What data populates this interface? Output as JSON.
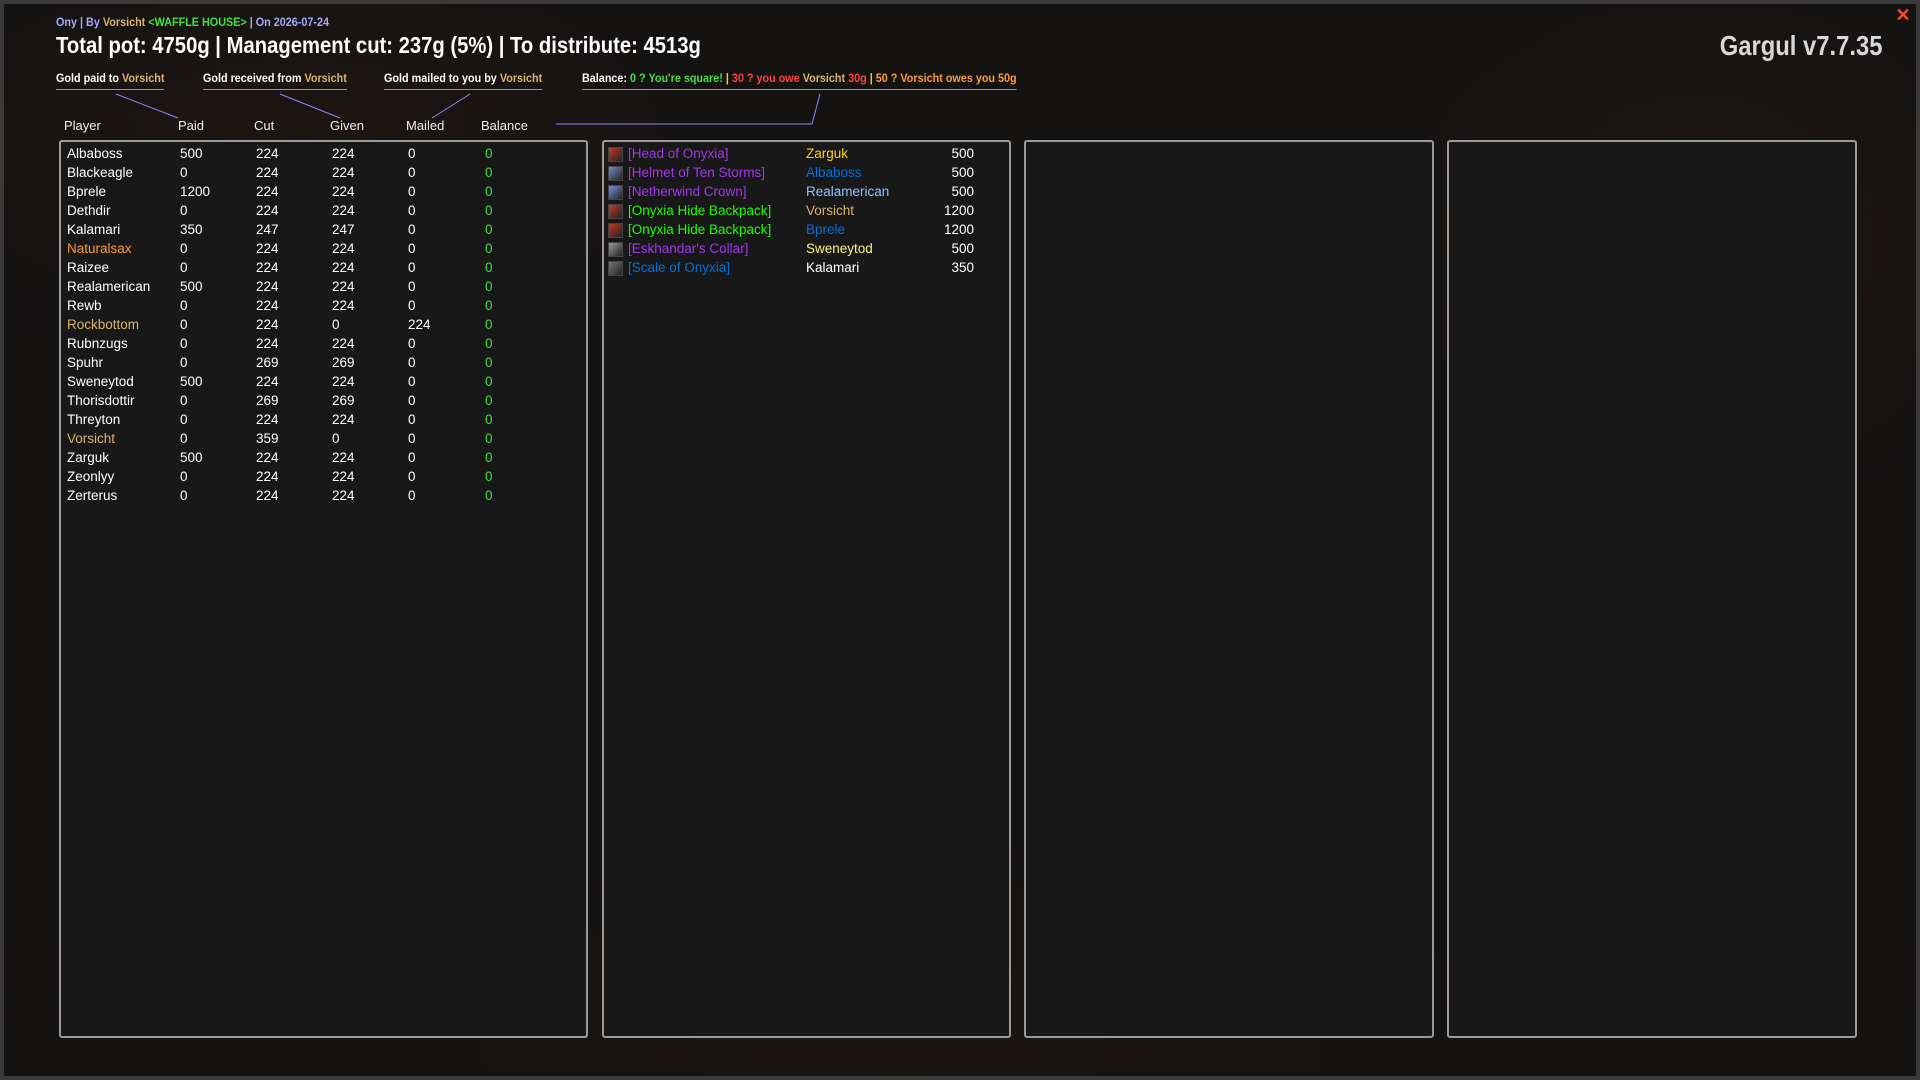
{
  "header": {
    "raid": "Ony",
    "by_prefix": "By",
    "author": "Vorsicht",
    "guild": "<WAFFLE HOUSE>",
    "on_prefix": "On",
    "date": "2026-07-24",
    "headline": "Total pot: 4750g | Management cut: 237g (5%) | To distribute: 4513g",
    "version": "Gargul v7.7.35"
  },
  "legend": {
    "paid_label": "Gold paid to",
    "received_label": "Gold received from",
    "mailed_label": "Gold mailed to you by",
    "name": "Vorsicht",
    "balance_label": "Balance:",
    "square": "0 ? You're square!",
    "owe_prefix": "30 ? you owe",
    "owe_amount": "30g",
    "owes_you": "50 ? Vorsicht owes you 50g",
    "sep": "|"
  },
  "columns": {
    "player": "Player",
    "paid": "Paid",
    "cut": "Cut",
    "given": "Given",
    "mailed": "Mailed",
    "balance": "Balance"
  },
  "colors": {
    "default_name": "#ffffff",
    "orange_name": "#ff9a30",
    "gold_name": "#d9b46b",
    "balance": "#40e040",
    "epic": "#a335ee",
    "uncommon": "#1eff00",
    "rare": "#0070dd",
    "legend_line": "#8888ff"
  },
  "players": [
    {
      "name": "Albaboss",
      "paid": "500",
      "cut": "224",
      "given": "224",
      "mailed": "0",
      "balance": "0",
      "color": "#ffffff"
    },
    {
      "name": "Blackeagle",
      "paid": "0",
      "cut": "224",
      "given": "224",
      "mailed": "0",
      "balance": "0",
      "color": "#ffffff"
    },
    {
      "name": "Bprele",
      "paid": "1200",
      "cut": "224",
      "given": "224",
      "mailed": "0",
      "balance": "0",
      "color": "#ffffff"
    },
    {
      "name": "Dethdir",
      "paid": "0",
      "cut": "224",
      "given": "224",
      "mailed": "0",
      "balance": "0",
      "color": "#ffffff"
    },
    {
      "name": "Kalamari",
      "paid": "350",
      "cut": "247",
      "given": "247",
      "mailed": "0",
      "balance": "0",
      "color": "#ffffff"
    },
    {
      "name": "Naturalsax",
      "paid": "0",
      "cut": "224",
      "given": "224",
      "mailed": "0",
      "balance": "0",
      "color": "#ff9a30"
    },
    {
      "name": "Raizee",
      "paid": "0",
      "cut": "224",
      "given": "224",
      "mailed": "0",
      "balance": "0",
      "color": "#ffffff"
    },
    {
      "name": "Realamerican",
      "paid": "500",
      "cut": "224",
      "given": "224",
      "mailed": "0",
      "balance": "0",
      "color": "#ffffff"
    },
    {
      "name": "Rewb",
      "paid": "0",
      "cut": "224",
      "given": "224",
      "mailed": "0",
      "balance": "0",
      "color": "#ffffff"
    },
    {
      "name": "Rockbottom",
      "paid": "0",
      "cut": "224",
      "given": "0",
      "mailed": "224",
      "balance": "0",
      "color": "#d9b46b"
    },
    {
      "name": "Rubnzugs",
      "paid": "0",
      "cut": "224",
      "given": "224",
      "mailed": "0",
      "balance": "0",
      "color": "#ffffff"
    },
    {
      "name": "Spuhr",
      "paid": "0",
      "cut": "269",
      "given": "269",
      "mailed": "0",
      "balance": "0",
      "color": "#ffffff"
    },
    {
      "name": "Sweneytod",
      "paid": "500",
      "cut": "224",
      "given": "224",
      "mailed": "0",
      "balance": "0",
      "color": "#ffffff"
    },
    {
      "name": "Thorisdottir",
      "paid": "0",
      "cut": "269",
      "given": "269",
      "mailed": "0",
      "balance": "0",
      "color": "#ffffff"
    },
    {
      "name": "Threyton",
      "paid": "0",
      "cut": "224",
      "given": "224",
      "mailed": "0",
      "balance": "0",
      "color": "#ffffff"
    },
    {
      "name": "Vorsicht",
      "paid": "0",
      "cut": "359",
      "given": "0",
      "mailed": "0",
      "balance": "0",
      "color": "#d9b46b"
    },
    {
      "name": "Zarguk",
      "paid": "500",
      "cut": "224",
      "given": "224",
      "mailed": "0",
      "balance": "0",
      "color": "#ffffff"
    },
    {
      "name": "Zeonlyy",
      "paid": "0",
      "cut": "224",
      "given": "224",
      "mailed": "0",
      "balance": "0",
      "color": "#ffffff"
    },
    {
      "name": "Zerterus",
      "paid": "0",
      "cut": "224",
      "given": "224",
      "mailed": "0",
      "balance": "0",
      "color": "#ffffff"
    }
  ],
  "loot": [
    {
      "item": "[Head of Onyxia]",
      "item_color": "#a335ee",
      "icon": "onyxia-head-icon",
      "icon_color": "#c0392b",
      "winner": "Zarguk",
      "winner_color": "#ffd200",
      "price": "500"
    },
    {
      "item": "[Helmet of Ten Storms]",
      "item_color": "#a335ee",
      "icon": "helmet-icon",
      "icon_color": "#6f8ec9",
      "winner": "Albaboss",
      "winner_color": "#0070dd",
      "price": "500"
    },
    {
      "item": "[Netherwind Crown]",
      "item_color": "#a335ee",
      "icon": "crown-icon",
      "icon_color": "#7a8fd8",
      "winner": "Realamerican",
      "winner_color": "#8ec5ff",
      "price": "500"
    },
    {
      "item": "[Onyxia Hide Backpack]",
      "item_color": "#1eff00",
      "icon": "backpack-icon",
      "icon_color": "#c0392b",
      "winner": "Vorsicht",
      "winner_color": "#d9b46b",
      "price": "1200"
    },
    {
      "item": "[Onyxia Hide Backpack]",
      "item_color": "#1eff00",
      "icon": "backpack-icon",
      "icon_color": "#c0392b",
      "winner": "Bprele",
      "winner_color": "#0070dd",
      "price": "1200"
    },
    {
      "item": "[Eskhandar's Collar]",
      "item_color": "#a335ee",
      "icon": "collar-icon",
      "icon_color": "#9a9a9a",
      "winner": "Sweneytod",
      "winner_color": "#fff27a",
      "price": "500"
    },
    {
      "item": "[Scale of Onyxia]",
      "item_color": "#0070dd",
      "icon": "scale-icon",
      "icon_color": "#777777",
      "winner": "Kalamari",
      "winner_color": "#ffffff",
      "price": "350"
    }
  ]
}
